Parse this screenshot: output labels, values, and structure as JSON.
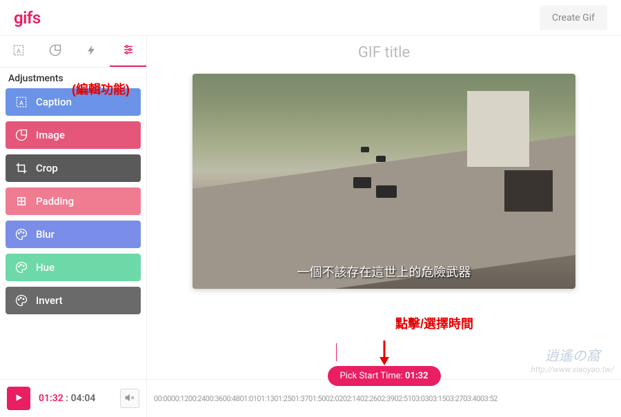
{
  "header": {
    "logo": "gifs",
    "create_btn": "Create Gif"
  },
  "sidebar": {
    "section_title": "Adjustments",
    "items": [
      {
        "id": "caption",
        "label": "Caption",
        "color": "#6b93e8"
      },
      {
        "id": "image",
        "label": "Image",
        "color": "#e5577a"
      },
      {
        "id": "crop",
        "label": "Crop",
        "color": "#5a5a5a"
      },
      {
        "id": "padding",
        "label": "Padding",
        "color": "#f07c92"
      },
      {
        "id": "blur",
        "label": "Blur",
        "color": "#7a8de8"
      },
      {
        "id": "hue",
        "label": "Hue",
        "color": "#6dd9a8"
      },
      {
        "id": "invert",
        "label": "Invert",
        "color": "#6a6a6a"
      }
    ]
  },
  "content": {
    "title_placeholder": "GIF title",
    "subtitle_text": "一個不該存在這世上的危險武器"
  },
  "pick_time": {
    "label": "Pick Start Time:",
    "value": "01:32"
  },
  "controls": {
    "current_time": "01:32",
    "total_time": "04:04"
  },
  "timeline": {
    "ticks": "00:0000:1200:2400:3600:4801:0101:1301:2501:3701:5002:0202:1402:2602:3902:5103:0303:1503:2703:4003:52"
  },
  "annotations": {
    "edit_feature": "(編輯功能)",
    "click_time": "點擊/選擇時間"
  },
  "watermark": {
    "main": "逍遙の窩",
    "url": "http://www.xiaoyao.tw/"
  }
}
